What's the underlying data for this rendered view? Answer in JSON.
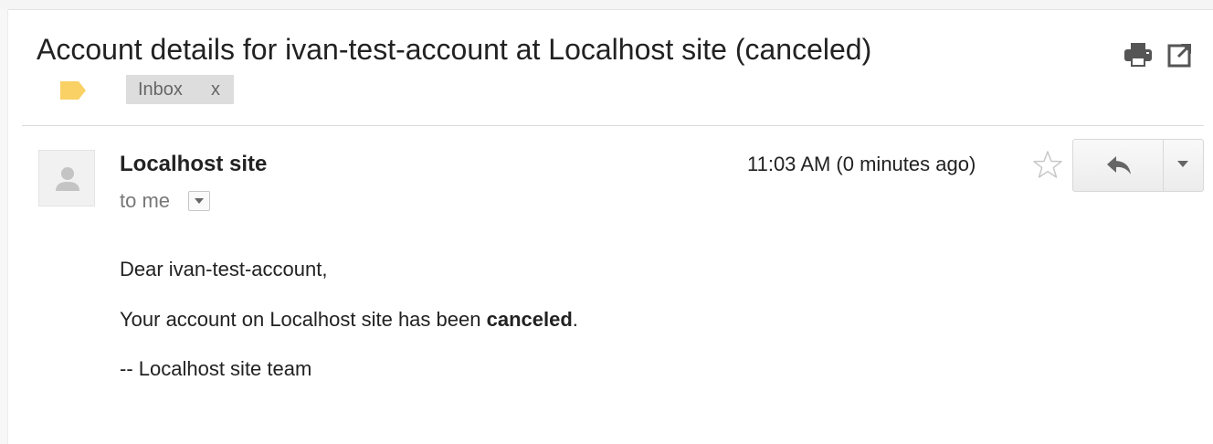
{
  "message": {
    "subject": "Account details for ivan-test-account at Localhost site (canceled)",
    "labels": [
      {
        "name": "Inbox",
        "remove_label": "x"
      }
    ],
    "sender": "Localhost site",
    "recipient": "to me",
    "timestamp": "11:03 AM (0 minutes ago)",
    "body": {
      "greeting": "Dear ivan-test-account,",
      "status_prefix": "Your account on Localhost site has been ",
      "status_word": "canceled",
      "status_suffix": ".",
      "signature": "-- Localhost site team"
    }
  },
  "icons": {
    "label_tag": "label-tag-icon",
    "print": "print-icon",
    "new_window": "new-window-icon",
    "avatar": "avatar-icon",
    "details": "chevron-down-icon",
    "star": "star-icon",
    "reply": "reply-icon",
    "more": "dropdown-arrow-icon"
  },
  "colors": {
    "label_tag": "#fad165",
    "chip_background": "#dddddd",
    "muted_text": "#777777"
  }
}
